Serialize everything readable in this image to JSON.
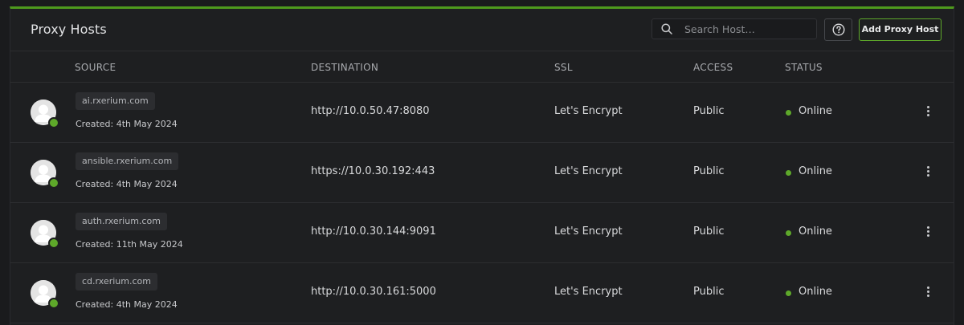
{
  "header": {
    "title": "Proxy Hosts",
    "search_placeholder": "Search Host…",
    "add_button_label": "Add Proxy Host"
  },
  "table": {
    "columns": {
      "source": "SOURCE",
      "destination": "DESTINATION",
      "ssl": "SSL",
      "access": "ACCESS",
      "status": "STATUS"
    },
    "rows": [
      {
        "domain": "ai.rxerium.com",
        "created": "Created: 4th May 2024",
        "destination": "http://10.0.50.47:8080",
        "ssl": "Let's Encrypt",
        "access": "Public",
        "status": "Online"
      },
      {
        "domain": "ansible.rxerium.com",
        "created": "Created: 4th May 2024",
        "destination": "https://10.0.30.192:443",
        "ssl": "Let's Encrypt",
        "access": "Public",
        "status": "Online"
      },
      {
        "domain": "auth.rxerium.com",
        "created": "Created: 11th May 2024",
        "destination": "http://10.0.30.144:9091",
        "ssl": "Let's Encrypt",
        "access": "Public",
        "status": "Online"
      },
      {
        "domain": "cd.rxerium.com",
        "created": "Created: 4th May 2024",
        "destination": "http://10.0.30.161:5000",
        "ssl": "Let's Encrypt",
        "access": "Public",
        "status": "Online"
      }
    ]
  },
  "colors": {
    "accent": "#5ea82a",
    "background": "#1e1f21",
    "online": "#5ea82a"
  },
  "icons": {
    "search": "search-icon",
    "help": "question-circle-icon",
    "avatar": "user-avatar-icon",
    "menu": "kebab-menu-icon"
  }
}
